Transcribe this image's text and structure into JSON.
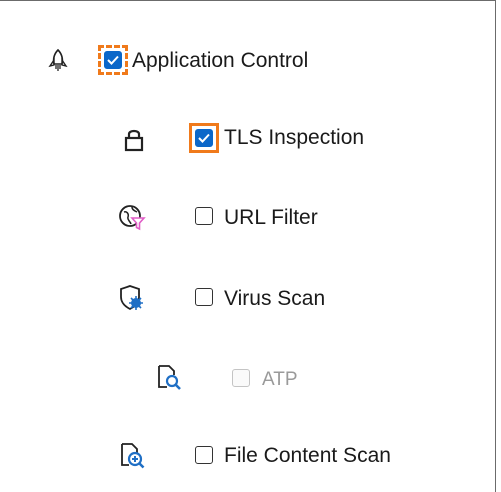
{
  "tree": {
    "items": [
      {
        "id": "application-control",
        "label": "Application Control",
        "checked": true,
        "disabled": false,
        "icon": "rocket-icon"
      },
      {
        "id": "tls-inspection",
        "label": "TLS Inspection",
        "checked": true,
        "disabled": false,
        "icon": "lock-icon"
      },
      {
        "id": "url-filter",
        "label": "URL Filter",
        "checked": false,
        "disabled": false,
        "icon": "globe-filter-icon"
      },
      {
        "id": "virus-scan",
        "label": "Virus Scan",
        "checked": false,
        "disabled": false,
        "icon": "shield-virus-icon"
      },
      {
        "id": "atp",
        "label": "ATP",
        "checked": false,
        "disabled": true,
        "icon": "document-search-icon"
      },
      {
        "id": "file-content-scan",
        "label": "File Content Scan",
        "checked": false,
        "disabled": false,
        "icon": "document-zoom-icon"
      }
    ]
  },
  "colors": {
    "checkbox_checked": "#0b67c9",
    "focus_outline": "#f07a1b",
    "icon_blue": "#1f6fc5",
    "icon_pink": "#e05cc6",
    "disabled_text": "#9a9a9a"
  }
}
